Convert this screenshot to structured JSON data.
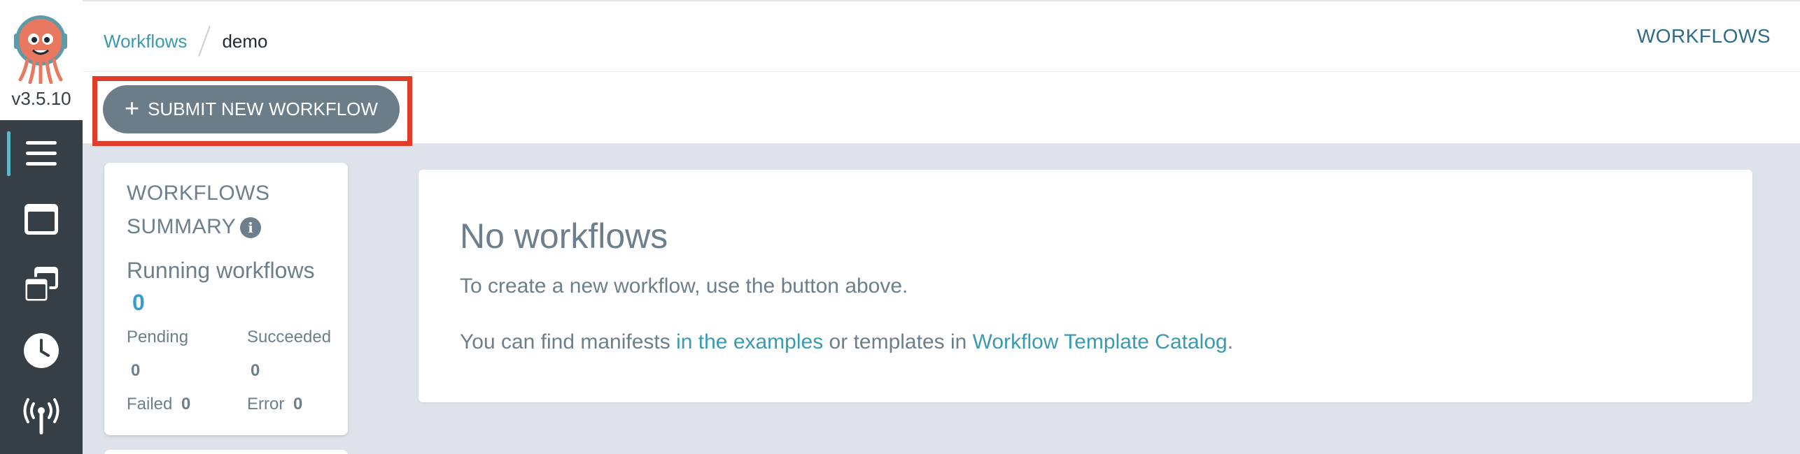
{
  "app": {
    "version": "v3.5.10"
  },
  "sidebar": {
    "items": [
      {
        "icon": "hamburger-icon",
        "active": true
      },
      {
        "icon": "window-icon",
        "active": false
      },
      {
        "icon": "stacked-windows-icon",
        "active": false
      },
      {
        "icon": "clock-icon",
        "active": false
      },
      {
        "icon": "broadcast-icon",
        "active": false
      }
    ]
  },
  "breadcrumb": {
    "root": "Workflows",
    "current": "demo"
  },
  "header": {
    "title": "WORKFLOWS"
  },
  "actions": {
    "submit_icon": "+",
    "submit_label": "SUBMIT NEW WORKFLOW"
  },
  "summary": {
    "title_line1": "WORKFLOWS",
    "title_line2": "SUMMARY",
    "info_icon": "i",
    "running_label": "Running workflows",
    "running_count": "0",
    "pending_label": "Pending",
    "pending_count": "0",
    "succeeded_label": "Succeeded",
    "succeeded_count": "0",
    "failed_label": "Failed",
    "failed_count": "0",
    "error_label": "Error",
    "error_count": "0"
  },
  "empty_state": {
    "title": "No workflows",
    "line1": "To create a new workflow, use the button above.",
    "line2_prefix": "You can find manifests ",
    "examples_link": "in the examples",
    "line2_middle": " or templates in ",
    "catalog_link": "Workflow Template Catalog",
    "line2_suffix": "."
  },
  "colors": {
    "accent": "#3a9bb0",
    "sidebar_bg": "#373f46",
    "highlight": "#e23b2a",
    "button_bg": "#6b7d89",
    "page_bg": "#dee3eb"
  }
}
